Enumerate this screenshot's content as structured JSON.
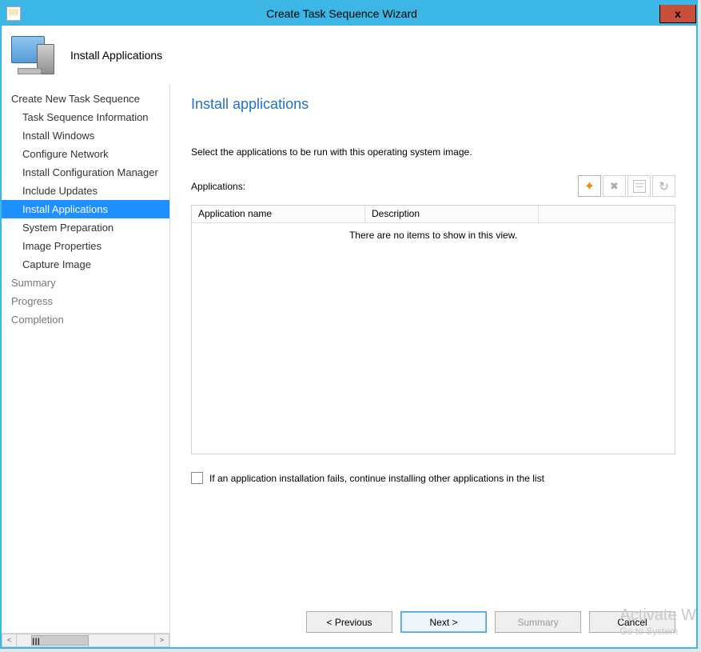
{
  "window": {
    "title": "Create Task Sequence Wizard",
    "close_label": "x"
  },
  "header": {
    "section_label": "Install Applications"
  },
  "sidebar": {
    "items": [
      {
        "label": "Create New Task Sequence",
        "child": false,
        "selected": false,
        "disabled": false
      },
      {
        "label": "Task Sequence Information",
        "child": true,
        "selected": false,
        "disabled": false
      },
      {
        "label": "Install Windows",
        "child": true,
        "selected": false,
        "disabled": false
      },
      {
        "label": "Configure Network",
        "child": true,
        "selected": false,
        "disabled": false
      },
      {
        "label": "Install Configuration Manager",
        "child": true,
        "selected": false,
        "disabled": false
      },
      {
        "label": "Include Updates",
        "child": true,
        "selected": false,
        "disabled": false
      },
      {
        "label": "Install Applications",
        "child": true,
        "selected": true,
        "disabled": false
      },
      {
        "label": "System Preparation",
        "child": true,
        "selected": false,
        "disabled": false
      },
      {
        "label": "Image Properties",
        "child": true,
        "selected": false,
        "disabled": false
      },
      {
        "label": "Capture Image",
        "child": true,
        "selected": false,
        "disabled": false
      },
      {
        "label": "Summary",
        "child": false,
        "selected": false,
        "disabled": true
      },
      {
        "label": "Progress",
        "child": false,
        "selected": false,
        "disabled": true
      },
      {
        "label": "Completion",
        "child": false,
        "selected": false,
        "disabled": true
      }
    ],
    "scroll": {
      "left_glyph": "<",
      "right_glyph": ">",
      "thumb_hint": "III"
    }
  },
  "main": {
    "page_title": "Install applications",
    "instruction": "Select the applications to be run with this operating system image.",
    "apps_label": "Applications:",
    "toolbar": {
      "add_tip": "New",
      "remove_tip": "Delete",
      "props_tip": "Properties",
      "refresh_tip": "Clear"
    },
    "table": {
      "col1": "Application name",
      "col2": "Description",
      "empty_msg": "There are no items to show in this view.",
      "rows": []
    },
    "checkbox_label": "If an application installation fails, continue installing other applications in the list",
    "checkbox_checked": false
  },
  "footer": {
    "previous": "<  Previous",
    "next": "Next  >",
    "summary": "Summary",
    "cancel": "Cancel"
  },
  "watermark": {
    "line1": "Activate W",
    "line2": "Go to System"
  }
}
